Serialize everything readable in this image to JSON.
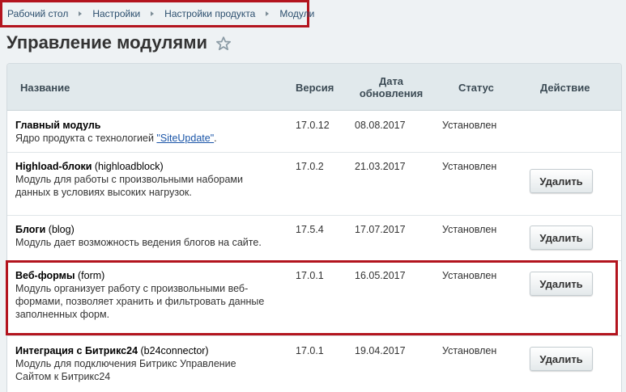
{
  "breadcrumb": {
    "items": [
      "Рабочий стол",
      "Настройки",
      "Настройки продукта",
      "Модули"
    ]
  },
  "page": {
    "title": "Управление модулями"
  },
  "table": {
    "headers": {
      "name": "Название",
      "version": "Версия",
      "date_line1": "Дата",
      "date_line2": "обновления",
      "status": "Статус",
      "action": "Действие"
    },
    "rows": [
      {
        "name": "Главный модуль",
        "code": "",
        "desc_line1_prefix": "Ядро продукта с технологией ",
        "desc_link": "\"SiteUpdate\"",
        "desc_line1_suffix": ".",
        "version": "17.0.12",
        "date": "08.08.2017",
        "status": "Установлен",
        "action": ""
      },
      {
        "name": "Highload-блоки",
        "code": "(highloadblock)",
        "desc_line1": "Модуль для работы с произвольными наборами",
        "desc_line2": "данных в условиях высоких нагрузок.",
        "version": "17.0.2",
        "date": "21.03.2017",
        "status": "Установлен",
        "action": "Удалить"
      },
      {
        "name": "Блоги",
        "code": "(blog)",
        "desc_line1": "Модуль дает возможность ведения блогов на сайте.",
        "version": "17.5.4",
        "date": "17.07.2017",
        "status": "Установлен",
        "action": "Удалить"
      },
      {
        "name": "Веб-формы",
        "code": "(form)",
        "desc_line1": "Модуль организует работу с произвольными веб-",
        "desc_line2": "формами, позволяет хранить и фильтровать данные",
        "desc_line3": "заполненных форм.",
        "version": "17.0.1",
        "date": "16.05.2017",
        "status": "Установлен",
        "action": "Удалить"
      },
      {
        "name": "Интеграция с Битрикс24",
        "code": "(b24connector)",
        "desc_line1": "Модуль для подключения Битрикс Управление",
        "desc_line2": "Сайтом к Битрикс24",
        "version": "17.0.1",
        "date": "19.04.2017",
        "status": "Установлен",
        "action": "Удалить"
      }
    ]
  },
  "colors": {
    "highlight": "#b3141e",
    "link": "#1a55a8",
    "header_bg": "#e1e9ec"
  }
}
